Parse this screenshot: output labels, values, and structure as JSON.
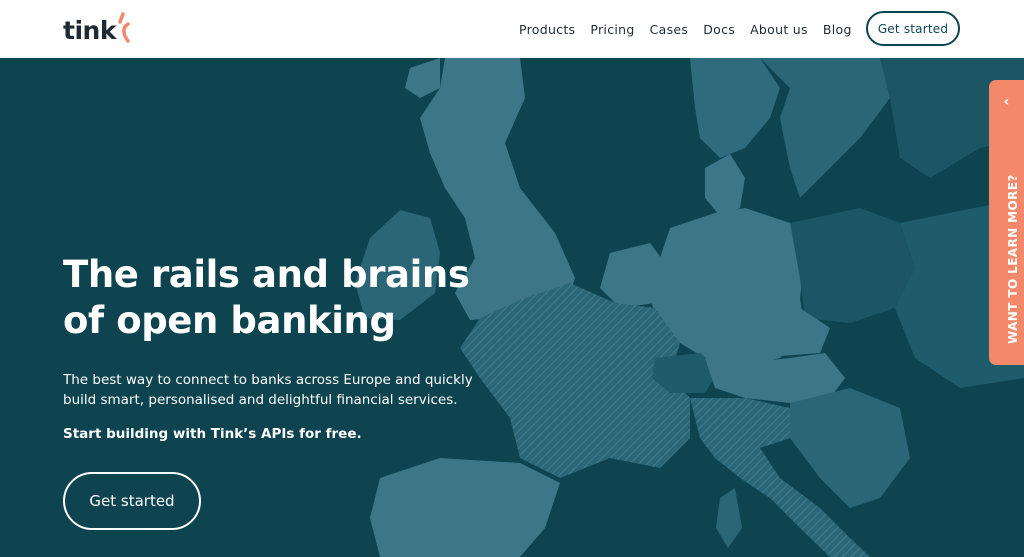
{
  "brand": {
    "name": "tink",
    "accent_color": "#f4886a",
    "dark_color": "#0e4450"
  },
  "nav": {
    "items": [
      "Products",
      "Pricing",
      "Cases",
      "Docs",
      "About us",
      "Blog"
    ],
    "cta_label": "Get started"
  },
  "hero": {
    "headline_line1": "The rails and brains",
    "headline_line2": "of open banking",
    "description": "The best way to connect to banks across Europe and quickly build smart, personalised and delightful financial services.",
    "emphasis": "Start building with Tink’s APIs for free.",
    "cta_label": "Get started"
  },
  "side_tab": {
    "label": "WANT TO LEARN MORE?",
    "icon": "chevron-left-icon"
  }
}
